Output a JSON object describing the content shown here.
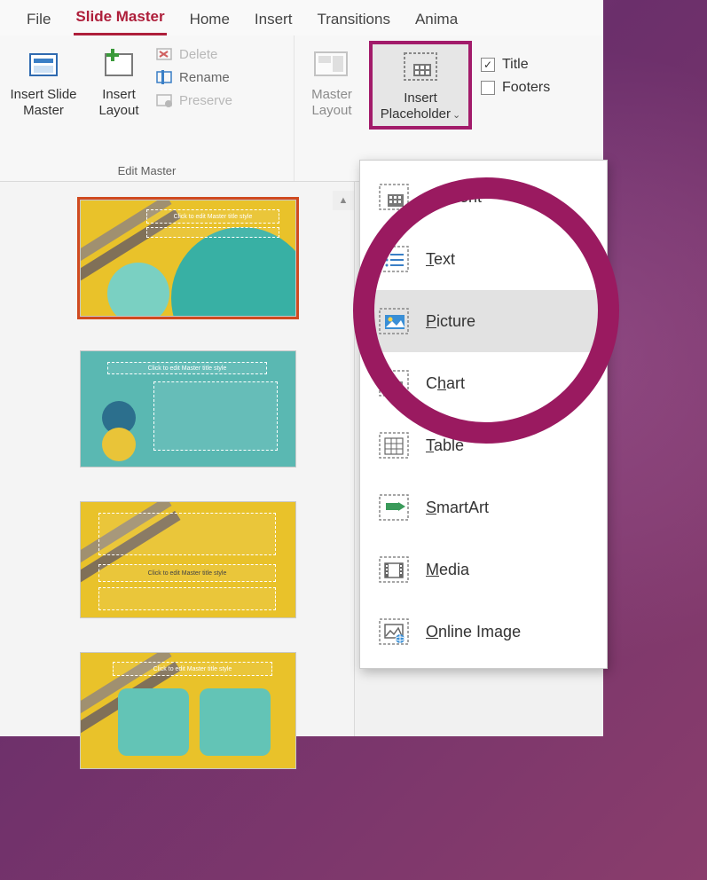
{
  "tabs": {
    "file": "File",
    "slide_master": "Slide Master",
    "home": "Home",
    "insert": "Insert",
    "transitions": "Transitions",
    "animations": "Anima"
  },
  "ribbon": {
    "edit_master_group_label": "Edit Master",
    "insert_slide_master": "Insert Slide Master",
    "insert_layout": "Insert Layout",
    "delete": "Delete",
    "rename": "Rename",
    "preserve": "Preserve",
    "master_layout": "Master Layout",
    "insert_placeholder": "Insert Placeholder",
    "title_checkbox": "Title",
    "footers_checkbox": "Footers"
  },
  "placeholder_menu": {
    "content": "Content",
    "text": "Text",
    "picture": "Picture",
    "chart": "Chart",
    "table": "Table",
    "smartart": "SmartArt",
    "media": "Media",
    "online_image": "Online Image",
    "access_keys": {
      "content": "C",
      "text": "T",
      "picture": "P",
      "chart": "h",
      "table": "T",
      "smartart": "S",
      "media": "M",
      "online_image": "O"
    }
  },
  "thumbnails": {
    "ph_text": "Click to edit Master title style"
  }
}
